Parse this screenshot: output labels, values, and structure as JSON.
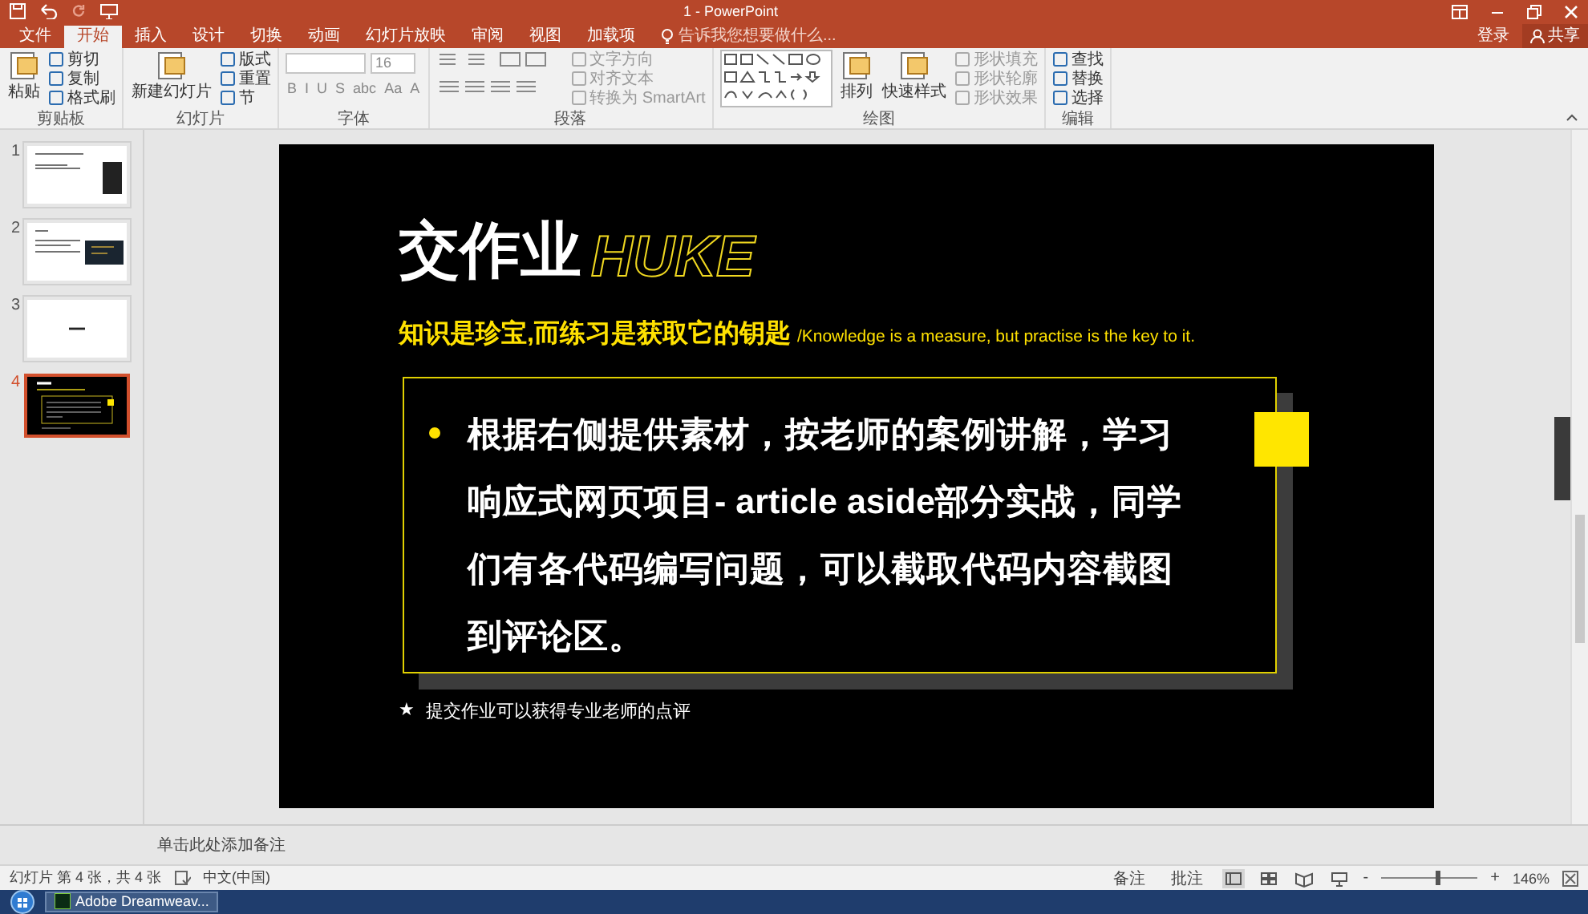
{
  "title_bar": {
    "title": "1 - PowerPoint"
  },
  "menu_tabs": [
    {
      "label": "文件",
      "selected": false
    },
    {
      "label": "开始",
      "selected": true
    },
    {
      "label": "插入",
      "selected": false
    },
    {
      "label": "设计",
      "selected": false
    },
    {
      "label": "切换",
      "selected": false
    },
    {
      "label": "动画",
      "selected": false
    },
    {
      "label": "幻灯片放映",
      "selected": false
    },
    {
      "label": "审阅",
      "selected": false
    },
    {
      "label": "视图",
      "selected": false
    },
    {
      "label": "加载项",
      "selected": false
    }
  ],
  "tell_me": {
    "placeholder": "告诉我您想要做什么..."
  },
  "sign_in": "登录",
  "share": "共享",
  "ribbon": {
    "groups": [
      {
        "label": "剪贴板",
        "columns": [
          {
            "kind": "large",
            "label": "粘贴"
          },
          {
            "kind": "stack",
            "disabled": false,
            "items": [
              "剪切",
              "复制",
              "格式刷"
            ]
          }
        ]
      },
      {
        "label": "幻灯片",
        "columns": [
          {
            "kind": "large",
            "label": "新建幻灯片"
          },
          {
            "kind": "stack",
            "disabled": false,
            "items": [
              "版式",
              "重置",
              "节"
            ]
          }
        ]
      },
      {
        "label": "字体",
        "columns": [
          {
            "kind": "font",
            "size": "16",
            "buttons": [
              "B",
              "I",
              "U",
              "S",
              "abc",
              "Aa",
              "A"
            ]
          }
        ]
      },
      {
        "label": "段落",
        "columns": [
          {
            "kind": "paragraph_tools"
          },
          {
            "kind": "stack",
            "disabled": true,
            "items": [
              "文字方向",
              "对齐文本",
              "转换为 SmartArt"
            ]
          }
        ]
      },
      {
        "label": "绘图",
        "columns": [
          {
            "kind": "shapes"
          },
          {
            "kind": "large",
            "label": "排列"
          },
          {
            "kind": "large",
            "label": "快速样式"
          },
          {
            "kind": "stack",
            "disabled": true,
            "items": [
              "形状填充",
              "形状轮廓",
              "形状效果"
            ]
          }
        ]
      },
      {
        "label": "编辑",
        "columns": [
          {
            "kind": "stack",
            "disabled": false,
            "items": [
              "查找",
              "替换",
              "选择"
            ]
          }
        ]
      }
    ]
  },
  "slides": [
    {
      "number": "1",
      "selected": false,
      "kind": "text_image"
    },
    {
      "number": "2",
      "selected": false,
      "kind": "text_code"
    },
    {
      "number": "3",
      "selected": false,
      "kind": "title_only"
    },
    {
      "number": "4",
      "selected": true,
      "kind": "dark"
    }
  ],
  "slide": {
    "title": "交作业",
    "watermark": "HUKE",
    "subtitle": "知识是珍宝,而练习是获取它的钥匙",
    "subtitle_en": "/Knowledge is a measure, but practise is the key to it.",
    "bullet": "根据右侧提供素材，按老师的案例讲解，学习响应式网页项目- article aside部分实战，同学们有各代码编写问题，可以截取代码内容截图到评论区。",
    "note_marker": "★",
    "note": "提交作业可以获得专业老师的点评"
  },
  "notes": {
    "placeholder": "单击此处添加备注"
  },
  "status_bar": {
    "slide_info": "幻灯片 第 4 张，共 4 张",
    "language": "中文(中国)",
    "notes_button": "备注",
    "comments_button": "批注",
    "zoom_out": "-",
    "zoom_in": "+",
    "zoom": {
      "level": 0.58
    },
    "zoom_value": "146%"
  },
  "taskbar": {
    "apps": [
      {
        "label": "Adobe Dreamweav..."
      }
    ]
  }
}
